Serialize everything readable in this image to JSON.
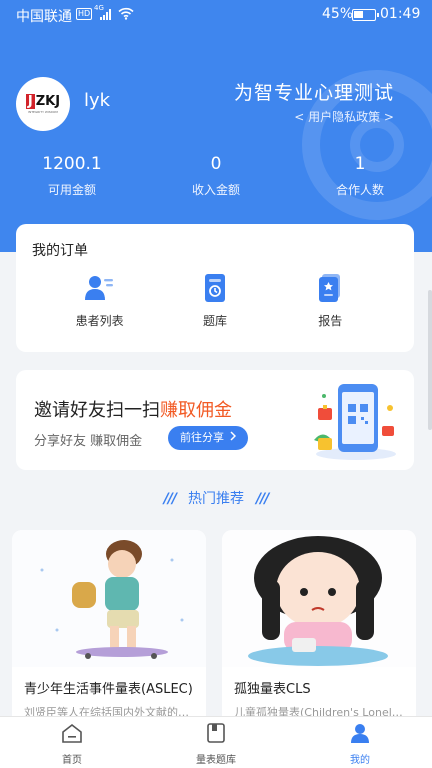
{
  "status_bar": {
    "carrier": "中国联通",
    "hd_badge": "HD",
    "network": "4G",
    "battery_percent": "45%",
    "battery_level": 0.45,
    "time": "01:49"
  },
  "profile": {
    "logo_text": "ZKJ",
    "logo_initial": "J",
    "logo_tagline": "INTEGRITY WISDOM",
    "username": "lyk",
    "brand_title": "为智专业心理测试",
    "privacy_link": "< 用户隐私政策 >"
  },
  "stats": [
    {
      "value": "1200.1",
      "label": "可用金额"
    },
    {
      "value": "0",
      "label": "收入金额"
    },
    {
      "value": "1",
      "label": "合作人数"
    }
  ],
  "orders": {
    "title": "我的订单",
    "items": [
      {
        "label": "患者列表",
        "icon": "patient-list-icon"
      },
      {
        "label": "题库",
        "icon": "question-bank-icon"
      },
      {
        "label": "报告",
        "icon": "report-icon"
      }
    ]
  },
  "invite": {
    "headline_prefix": "邀请好友扫一扫",
    "headline_accent": "赚取佣金",
    "subtext": "分享好友  赚取佣金",
    "button_label": "前往分享"
  },
  "hot": {
    "slashes": "///",
    "title": "热门推荐"
  },
  "recommendations": [
    {
      "name": "青少年生活事件量表(ASLEC)",
      "desc": "刘贤臣等人在综括国内外文献的基础上编制"
    },
    {
      "name": "孤独量表CLS",
      "desc": "儿童孤独量表(Children's Loneliness Scale)"
    }
  ],
  "tabs": [
    {
      "label": "首页",
      "icon": "home-icon",
      "active": false
    },
    {
      "label": "量表题库",
      "icon": "scale-library-icon",
      "active": false
    },
    {
      "label": "我的",
      "icon": "user-icon",
      "active": true
    }
  ],
  "colors": {
    "primary": "#3a7ff0",
    "hero_bg": "#3f86ee",
    "accent": "#f25a24"
  }
}
